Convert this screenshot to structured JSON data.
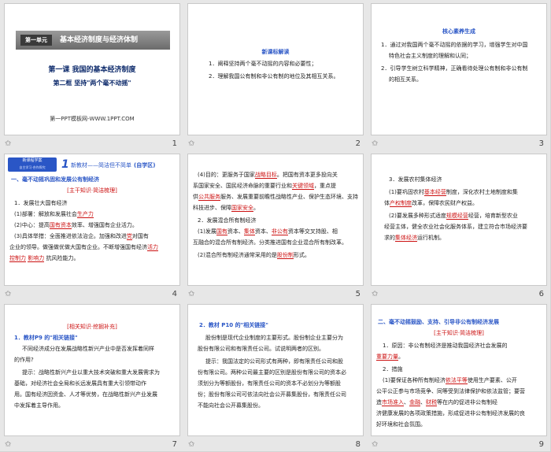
{
  "slides": [
    {
      "num": "1",
      "banner": {
        "unit": "第一单元",
        "title": "基本经济制度与经济体制"
      },
      "lesson": "第一课  我国的基本经济制度",
      "frame": "第二框  坚持\"两个毫不动摇\"",
      "site": "第一PPT模板网-WWW.1PPT.COM"
    },
    {
      "num": "2",
      "head": "新课标解读",
      "lines": [
        "1．阐释坚持两个毫不动摇的内容和必要性；",
        "2．理解我国公有制和非公有制的地位及其相互关系。"
      ]
    },
    {
      "num": "3",
      "head": "核心素养生成",
      "lines": [
        "1．通过对我国两个毫不动摇的依据的学习，增强学生对中国",
        "特色社会主义制度的理解和认同；",
        "2．引导学生树立科学精神，正确看待处理公有制和非公有制",
        "的相互关系。"
      ]
    },
    {
      "num": "4",
      "tag": "新课程学案",
      "tag_sub": "自主学习·合作探究",
      "badge": "1",
      "badge_title": "新教材——简洁但不简单",
      "badge_note": "(自学区)",
      "sec": "一、毫不动摇巩固和发展公有制经济",
      "sub": "[主干知识·简洁梳理]",
      "lines": [
        "1．发展壮大国有经济",
        "(1)部署：解放和发展社会",
        "(2)中心：提高",
        "效率、增强国有企业活力。",
        "(3)具体举措：全面推进依法治企。加强和改进",
        "对国有",
        "企业的领导。做强做优做大国有企业。不断增强国有经济",
        "控制力、",
        "影响力、",
        "抗风险能力。"
      ],
      "blanks": [
        "生产力",
        "国有资本",
        "党",
        "活力",
        "控制力",
        "影响力"
      ]
    },
    {
      "num": "5",
      "lines": [
        "(4)目的：更服务于国家",
        "。把国有资本更多投向关",
        "系国家安全、国民经济命脉的重要行业和",
        "，重点提",
        "供",
        "服务、发展重要前瞻性战略性产业、保护生态环境、支持",
        "科技进步、保障",
        "。",
        "2．发展混合所有制经济",
        "(1)发展",
        "资本、",
        "资本、",
        "资本等交叉持股、相",
        "互融合的混合所有制经济。分类推进国有企业混合所有制改革。",
        "(2)混合所有制经济通常采用的是",
        "形式。"
      ],
      "blanks": [
        "战略目标",
        "关键领域",
        "公共服务",
        "国家安全",
        "国有",
        "集体",
        "非公有",
        "股份制"
      ]
    },
    {
      "num": "6",
      "lines": [
        "3．发展农村集体经济",
        "(1)要巩固农村",
        "制度，深化农村土地制度和集",
        "体",
        "改革，保障农民财产权益。",
        "(2)要发展多种形式适度",
        "经营，培育新型农业",
        "经营主体，健全农业社会化服务体系，建立符合市场经济要",
        "求的",
        "运行机制。"
      ],
      "blanks": [
        "基本经营",
        "产权制度",
        "规模经营",
        "经营主体",
        "集体经济"
      ]
    },
    {
      "num": "7",
      "sub": "[相关知识·挖掘补充]",
      "lines": [
        "1．教材P9 的\"相关链接\"",
        "不同经济成分在发展战略性新兴产业中是否发挥着同样",
        "的作用?",
        "提示：战略性新兴产业以重大技术突破和重大发展需求为",
        "基础，对经济社会全局和长远发展具有重大引领带动作",
        "用。国有经济因资金、人才等优势，在战略性新兴产业发展",
        "中发挥着主导作用。"
      ]
    },
    {
      "num": "8",
      "lines": [
        "2．教材 P10 的\"相关链接\"",
        "股份制是现代企业制度的主要形式。股份制企业主要分为",
        "股份有限公司和有限责任公司。试说明两者的区别。",
        "提示：我国法定的公司形式有两种，即有限责任公司和股",
        "份有限公司。两种公司最主要的区别是股份有限公司的资本必",
        "须划分为等额股份，有限责任公司的资本不必划分为等额股",
        "份；股份有限公司可依法向社会公开募集股份，有限责任公司",
        "不能向社会公开募集股份。"
      ]
    },
    {
      "num": "9",
      "lines": [
        "二、毫不动摇鼓励、支持、引导非公有制经济发展",
        "[主干知识·简洁梳理]",
        "1．原因：非公有制经济是推动我国经济社会发展的",
        "重要力量",
        "。",
        "2．措施",
        "(1)要保证各种所有制经济",
        "使用生产要素、公开",
        "公平公正参与市场竞争、同等受到法律保护和依法监管；要营",
        "造",
        "、",
        "、",
        "等在内的促进非公有制经",
        "济健康发展的各项政策措施，形成促进非公有制经济发展的良",
        "好环境和社会氛围。"
      ],
      "blanks": [
        "重要力量",
        "依法平等",
        "市场准入",
        "金融",
        "财税"
      ]
    }
  ]
}
